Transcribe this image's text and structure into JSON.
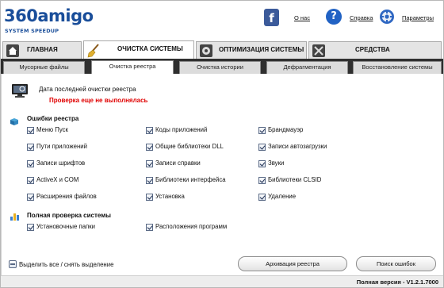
{
  "header": {
    "logo_text": "360amigo",
    "logo_subtitle": "SYSTEM SPEEDUP",
    "about_link": "О нас",
    "help_link": "Справка",
    "settings_link": "Параметры",
    "facebook_icon": "facebook-icon",
    "help_icon": "question-circle-icon",
    "settings_icon": "gear-icon"
  },
  "main_tabs": [
    {
      "label": "ГЛАВНАЯ",
      "icon": "home-icon",
      "active": false
    },
    {
      "label": "ОЧИСТКА СИСТЕМЫ",
      "icon": "broom-icon",
      "active": true
    },
    {
      "label": "ОПТИМИЗАЦИЯ СИСТЕМЫ",
      "icon": "gear-icon",
      "active": false
    },
    {
      "label": "СРЕДСТВА",
      "icon": "tools-icon",
      "active": false
    }
  ],
  "sub_tabs": [
    {
      "label": "Мусорные файлы",
      "active": false
    },
    {
      "label": "Очистка реестра",
      "active": true
    },
    {
      "label": "Очистка истории",
      "active": false
    },
    {
      "label": "Дефрагментация",
      "active": false
    },
    {
      "label": "Восстановление системы",
      "active": false
    }
  ],
  "registry_status": {
    "label": "Дата последней очистки реестра",
    "value": "Проверка еще не выполнялась",
    "value_color": "#e00000"
  },
  "registry_errors": {
    "title": "Ошибки реестра",
    "items": [
      {
        "label": "Меню Пуск",
        "checked": true
      },
      {
        "label": "Коды приложений",
        "checked": true
      },
      {
        "label": "Брандмауэр",
        "checked": true
      },
      {
        "label": "Пути приложений",
        "checked": true
      },
      {
        "label": "Общие библиотеки DLL",
        "checked": true
      },
      {
        "label": "Записи автозагрузки",
        "checked": true
      },
      {
        "label": "Записи шрифтов",
        "checked": true
      },
      {
        "label": "Записи справки",
        "checked": true
      },
      {
        "label": "Звуки",
        "checked": true
      },
      {
        "label": "ActiveX и COM",
        "checked": true
      },
      {
        "label": "Библиотеки интерфейса",
        "checked": true
      },
      {
        "label": "Библиотеки CLSID",
        "checked": true
      },
      {
        "label": "Расширения файлов",
        "checked": true
      },
      {
        "label": "Установка",
        "checked": true
      },
      {
        "label": "Удаление",
        "checked": true
      }
    ]
  },
  "full_check": {
    "title": "Полная проверка системы",
    "items": [
      {
        "label": "Установочные папки",
        "checked": true
      },
      {
        "label": "Расположения программ",
        "checked": true
      }
    ]
  },
  "select_all_label": "Выделить все / снять выделение",
  "buttons": {
    "archive": "Архивация реестра",
    "search": "Поиск ошибок"
  },
  "footer": {
    "version": "Полная версия  - V1.2.1.7000"
  }
}
